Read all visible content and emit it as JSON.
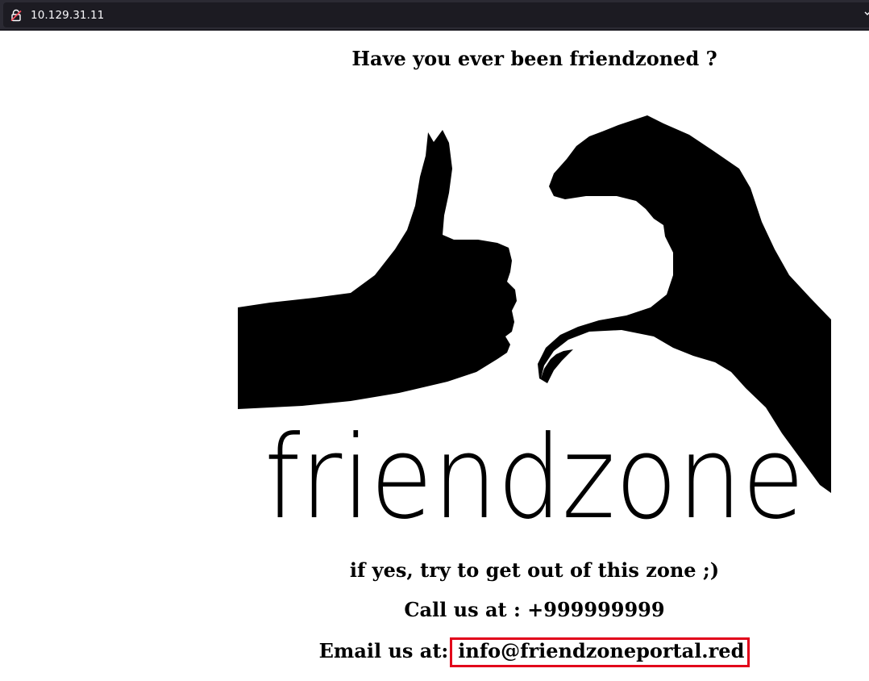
{
  "browser": {
    "url": "10.129.31.11"
  },
  "page": {
    "title": "Have you ever been friendzoned ?",
    "logo_text": "friendzone",
    "lines": {
      "escape": "if yes, try to get out of this zone ;)",
      "call": "Call us at : +999999999",
      "email_label": "Email us at:",
      "email_address": "info@friendzoneportal.red"
    }
  },
  "colors": {
    "highlight_box": "#e2001a"
  }
}
